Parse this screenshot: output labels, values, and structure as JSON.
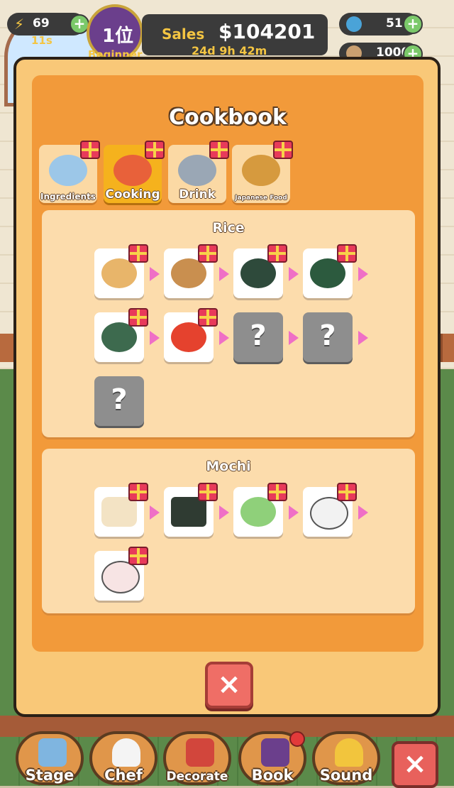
{
  "hud": {
    "energy": {
      "value": "69",
      "timer": "11s"
    },
    "rank": {
      "position": "1位",
      "level": "Beginner"
    },
    "sales": {
      "label": "Sales",
      "amount": "$104201",
      "time_left": "24d 9h 42m"
    },
    "gems": {
      "value": "51"
    },
    "coins": {
      "value": "1000"
    }
  },
  "modal": {
    "title": "Cookbook",
    "tabs": [
      {
        "label": "Ingredients",
        "icon": "fish-icon",
        "active": false
      },
      {
        "label": "Cooking",
        "icon": "ramen-bowl-icon",
        "active": true
      },
      {
        "label": "Drink",
        "icon": "drinks-tray-icon",
        "active": false
      },
      {
        "label": "Japanese Food",
        "icon": "fried-food-pot-icon",
        "active": false
      }
    ],
    "sections": [
      {
        "title": "Rice",
        "items": [
          {
            "icon": "rice-sack-icon",
            "locked": false
          },
          {
            "icon": "rice-bowl-icon",
            "locked": false
          },
          {
            "icon": "onigiri-icon",
            "locked": false
          },
          {
            "icon": "maki-roll-icon",
            "locked": false
          },
          {
            "icon": "gunkan-sushi-icon",
            "locked": false
          },
          {
            "icon": "salmon-nigiri-icon",
            "locked": false
          },
          {
            "icon": "unknown-icon",
            "locked": true,
            "label": "?"
          },
          {
            "icon": "unknown-icon",
            "locked": true,
            "label": "?"
          },
          {
            "icon": "unknown-icon",
            "locked": true,
            "label": "?"
          }
        ]
      },
      {
        "title": "Mochi",
        "items": [
          {
            "icon": "grilled-mochi-icon",
            "locked": false
          },
          {
            "icon": "isobe-mochi-icon",
            "locked": false
          },
          {
            "icon": "dango-plate-icon",
            "locked": false
          },
          {
            "icon": "daifuku-icon",
            "locked": false
          },
          {
            "icon": "strawberry-daifuku-icon",
            "locked": false
          }
        ]
      }
    ],
    "close_label": "×"
  },
  "bottom_nav": [
    {
      "label": "Stage",
      "icon": "map-icon"
    },
    {
      "label": "Chef",
      "icon": "chef-hat-icon"
    },
    {
      "label": "Decorate",
      "icon": "shop-icon"
    },
    {
      "label": "Book",
      "icon": "book-icon"
    },
    {
      "label": "Sound",
      "icon": "bell-icon"
    }
  ],
  "bottom_close_label": "×",
  "colors": {
    "modal_bg": "#f9c878",
    "panel_bg": "#f29a3a",
    "section_bg": "#fcdcac",
    "active_tab": "#f5b21d",
    "arrow": "#ef6fc6",
    "locked_item": "#8e8e8e",
    "close_button": "#ef6e66"
  }
}
